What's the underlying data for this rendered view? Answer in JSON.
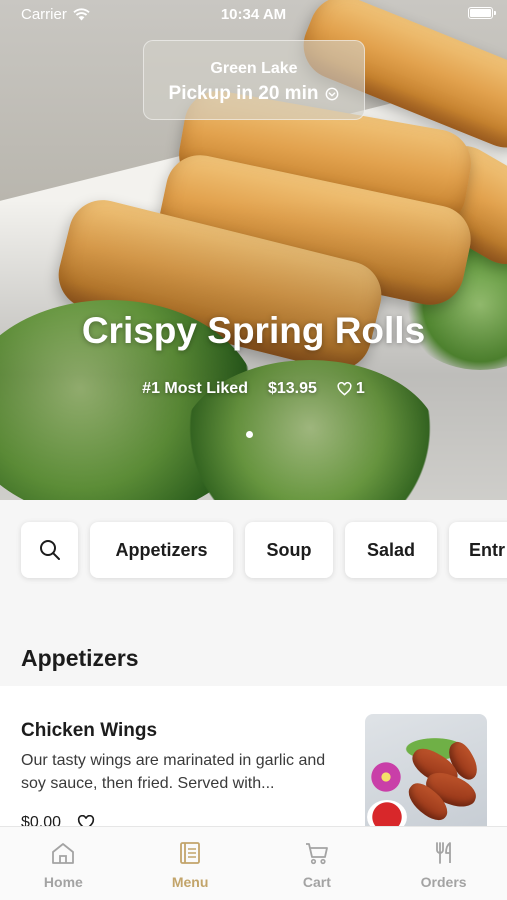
{
  "status_bar": {
    "carrier": "Carrier",
    "time": "10:34 AM"
  },
  "location": {
    "name": "Green Lake",
    "pickup": "Pickup in 20 min"
  },
  "hero": {
    "title": "Crispy Spring Rolls",
    "tag": "#1 Most Liked",
    "price": "$13.95",
    "likes": "1"
  },
  "categories": [
    "Appetizers",
    "Soup",
    "Salad",
    "Entr"
  ],
  "section_title": "Appetizers",
  "item": {
    "name": "Chicken Wings",
    "description": "Our tasty wings are marinated in garlic and soy sauce, then fried. Served with...",
    "price": "$0.00"
  },
  "tabs": [
    {
      "label": "Home",
      "icon": "home-icon"
    },
    {
      "label": "Menu",
      "icon": "menu-book-icon"
    },
    {
      "label": "Cart",
      "icon": "cart-icon"
    },
    {
      "label": "Orders",
      "icon": "fork-knife-icon"
    }
  ],
  "colors": {
    "accent": "#c2a46a",
    "inactive_tab": "#a3a3a3"
  }
}
